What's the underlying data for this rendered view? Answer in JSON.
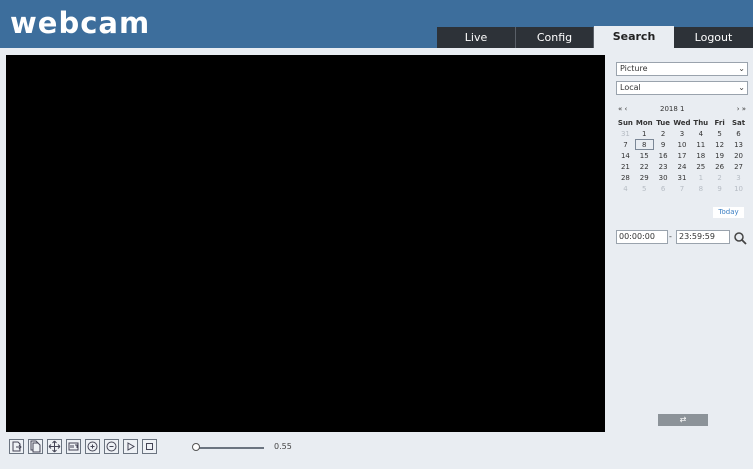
{
  "header": {
    "logo": "webcam",
    "tabs": [
      {
        "label": "Live"
      },
      {
        "label": "Config"
      },
      {
        "label": "Search"
      },
      {
        "label": "Logout"
      }
    ]
  },
  "toolbar": {
    "time": "0.55"
  },
  "panel": {
    "type_select": "Picture",
    "location_select": "Local",
    "calendar": {
      "prev": "«  ‹",
      "year_month": "2018  1",
      "next": "›  »",
      "weekdays": [
        "Sun",
        "Mon",
        "Tue",
        "Wed",
        "Thu",
        "Fri",
        "Sat"
      ],
      "weeks": [
        [
          "31",
          "1",
          "2",
          "3",
          "4",
          "5",
          "6"
        ],
        [
          "7",
          "8",
          "9",
          "10",
          "11",
          "12",
          "13"
        ],
        [
          "14",
          "15",
          "16",
          "17",
          "18",
          "19",
          "20"
        ],
        [
          "21",
          "22",
          "23",
          "24",
          "25",
          "26",
          "27"
        ],
        [
          "28",
          "29",
          "30",
          "31",
          "1",
          "2",
          "3"
        ],
        [
          "4",
          "5",
          "6",
          "7",
          "8",
          "9",
          "10"
        ]
      ],
      "today_label": "Today"
    },
    "start_time": "00:00:00",
    "separator": "-",
    "end_time": "23:59:59",
    "switch_label": "⇄"
  },
  "colors": {
    "header": "#3d6e9c",
    "tab_bg": "#2d3238",
    "background": "#e9edf2"
  }
}
